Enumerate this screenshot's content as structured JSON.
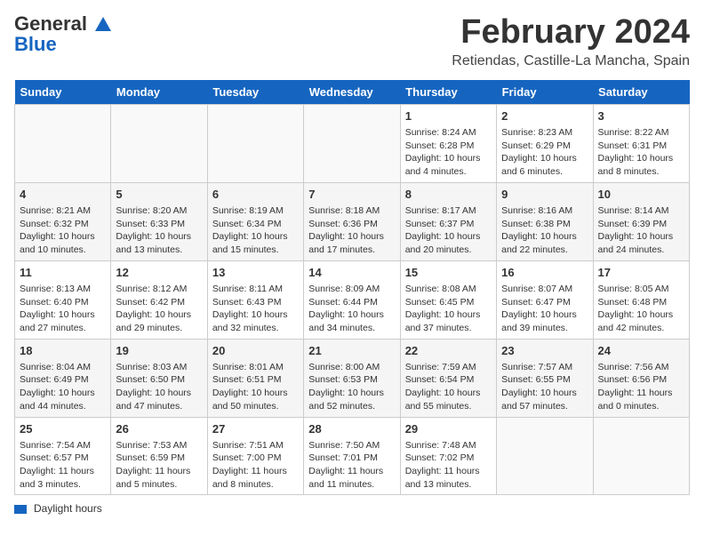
{
  "header": {
    "logo_general": "General",
    "logo_blue": "Blue",
    "month_title": "February 2024",
    "location": "Retiendas, Castille-La Mancha, Spain"
  },
  "days_of_week": [
    "Sunday",
    "Monday",
    "Tuesday",
    "Wednesday",
    "Thursday",
    "Friday",
    "Saturday"
  ],
  "weeks": [
    [
      {
        "day": "",
        "info": ""
      },
      {
        "day": "",
        "info": ""
      },
      {
        "day": "",
        "info": ""
      },
      {
        "day": "",
        "info": ""
      },
      {
        "day": "1",
        "info": "Sunrise: 8:24 AM\nSunset: 6:28 PM\nDaylight: 10 hours and 4 minutes."
      },
      {
        "day": "2",
        "info": "Sunrise: 8:23 AM\nSunset: 6:29 PM\nDaylight: 10 hours and 6 minutes."
      },
      {
        "day": "3",
        "info": "Sunrise: 8:22 AM\nSunset: 6:31 PM\nDaylight: 10 hours and 8 minutes."
      }
    ],
    [
      {
        "day": "4",
        "info": "Sunrise: 8:21 AM\nSunset: 6:32 PM\nDaylight: 10 hours and 10 minutes."
      },
      {
        "day": "5",
        "info": "Sunrise: 8:20 AM\nSunset: 6:33 PM\nDaylight: 10 hours and 13 minutes."
      },
      {
        "day": "6",
        "info": "Sunrise: 8:19 AM\nSunset: 6:34 PM\nDaylight: 10 hours and 15 minutes."
      },
      {
        "day": "7",
        "info": "Sunrise: 8:18 AM\nSunset: 6:36 PM\nDaylight: 10 hours and 17 minutes."
      },
      {
        "day": "8",
        "info": "Sunrise: 8:17 AM\nSunset: 6:37 PM\nDaylight: 10 hours and 20 minutes."
      },
      {
        "day": "9",
        "info": "Sunrise: 8:16 AM\nSunset: 6:38 PM\nDaylight: 10 hours and 22 minutes."
      },
      {
        "day": "10",
        "info": "Sunrise: 8:14 AM\nSunset: 6:39 PM\nDaylight: 10 hours and 24 minutes."
      }
    ],
    [
      {
        "day": "11",
        "info": "Sunrise: 8:13 AM\nSunset: 6:40 PM\nDaylight: 10 hours and 27 minutes."
      },
      {
        "day": "12",
        "info": "Sunrise: 8:12 AM\nSunset: 6:42 PM\nDaylight: 10 hours and 29 minutes."
      },
      {
        "day": "13",
        "info": "Sunrise: 8:11 AM\nSunset: 6:43 PM\nDaylight: 10 hours and 32 minutes."
      },
      {
        "day": "14",
        "info": "Sunrise: 8:09 AM\nSunset: 6:44 PM\nDaylight: 10 hours and 34 minutes."
      },
      {
        "day": "15",
        "info": "Sunrise: 8:08 AM\nSunset: 6:45 PM\nDaylight: 10 hours and 37 minutes."
      },
      {
        "day": "16",
        "info": "Sunrise: 8:07 AM\nSunset: 6:47 PM\nDaylight: 10 hours and 39 minutes."
      },
      {
        "day": "17",
        "info": "Sunrise: 8:05 AM\nSunset: 6:48 PM\nDaylight: 10 hours and 42 minutes."
      }
    ],
    [
      {
        "day": "18",
        "info": "Sunrise: 8:04 AM\nSunset: 6:49 PM\nDaylight: 10 hours and 44 minutes."
      },
      {
        "day": "19",
        "info": "Sunrise: 8:03 AM\nSunset: 6:50 PM\nDaylight: 10 hours and 47 minutes."
      },
      {
        "day": "20",
        "info": "Sunrise: 8:01 AM\nSunset: 6:51 PM\nDaylight: 10 hours and 50 minutes."
      },
      {
        "day": "21",
        "info": "Sunrise: 8:00 AM\nSunset: 6:53 PM\nDaylight: 10 hours and 52 minutes."
      },
      {
        "day": "22",
        "info": "Sunrise: 7:59 AM\nSunset: 6:54 PM\nDaylight: 10 hours and 55 minutes."
      },
      {
        "day": "23",
        "info": "Sunrise: 7:57 AM\nSunset: 6:55 PM\nDaylight: 10 hours and 57 minutes."
      },
      {
        "day": "24",
        "info": "Sunrise: 7:56 AM\nSunset: 6:56 PM\nDaylight: 11 hours and 0 minutes."
      }
    ],
    [
      {
        "day": "25",
        "info": "Sunrise: 7:54 AM\nSunset: 6:57 PM\nDaylight: 11 hours and 3 minutes."
      },
      {
        "day": "26",
        "info": "Sunrise: 7:53 AM\nSunset: 6:59 PM\nDaylight: 11 hours and 5 minutes."
      },
      {
        "day": "27",
        "info": "Sunrise: 7:51 AM\nSunset: 7:00 PM\nDaylight: 11 hours and 8 minutes."
      },
      {
        "day": "28",
        "info": "Sunrise: 7:50 AM\nSunset: 7:01 PM\nDaylight: 11 hours and 11 minutes."
      },
      {
        "day": "29",
        "info": "Sunrise: 7:48 AM\nSunset: 7:02 PM\nDaylight: 11 hours and 13 minutes."
      },
      {
        "day": "",
        "info": ""
      },
      {
        "day": "",
        "info": ""
      }
    ]
  ],
  "footer": {
    "legend_label": "Daylight hours"
  }
}
